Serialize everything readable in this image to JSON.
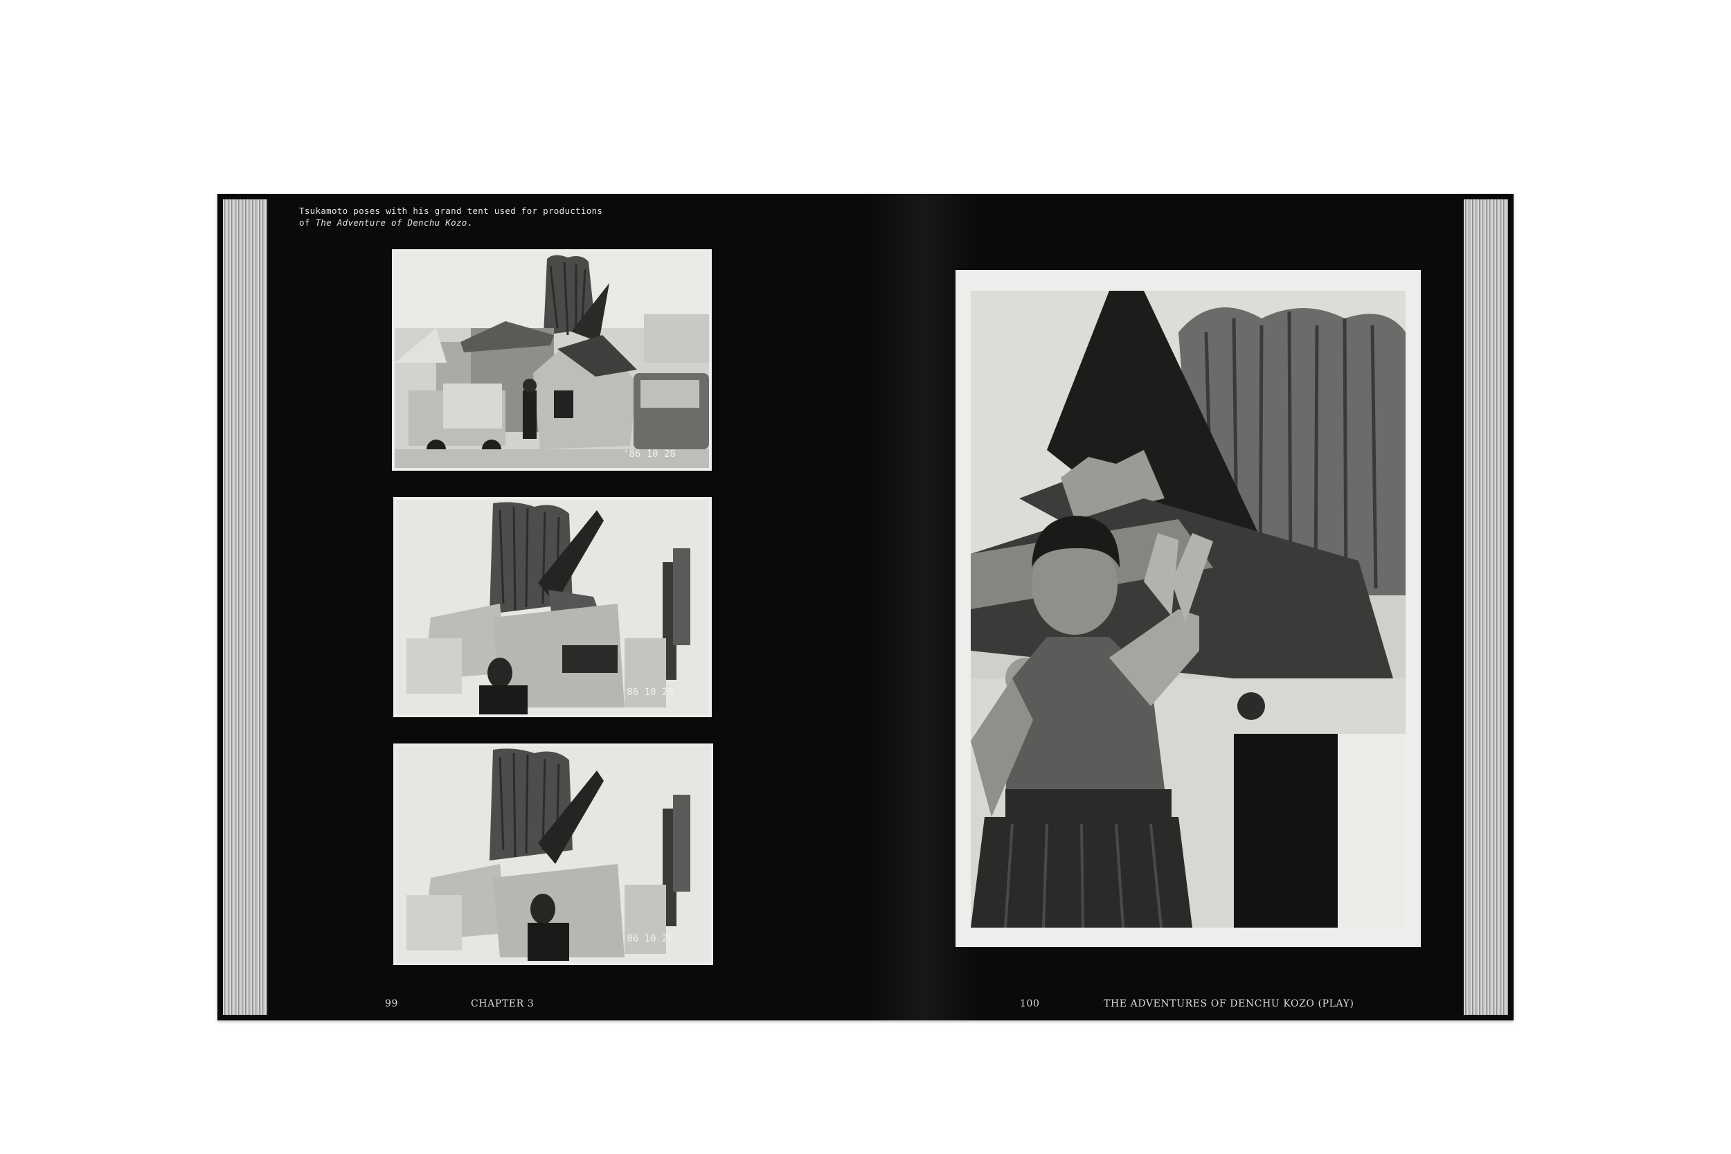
{
  "caption": {
    "line1": "Tsukamoto poses with his grand tent used for productions",
    "line2_prefix": "of ",
    "line2_title": "The Adventure of Denchu Kozo",
    "line2_suffix": "."
  },
  "photos": [
    {
      "date_stamp": "'86 10 28"
    },
    {
      "date_stamp": "'86 10 28"
    },
    {
      "date_stamp": "'86 10 28"
    }
  ],
  "folio": {
    "left_page_number": "99",
    "left_running_head": "CHAPTER 3",
    "right_page_number": "100",
    "right_running_head": "THE ADVENTURES OF DENCHU KOZO (PLAY)"
  },
  "colors": {
    "page": "#0a0a0a",
    "text": "#e6e6e6",
    "photo_border": "#ededeb",
    "date_stamp": "#f0f0f0"
  }
}
